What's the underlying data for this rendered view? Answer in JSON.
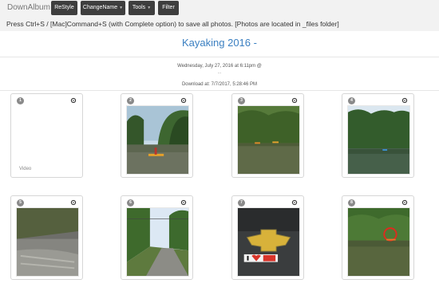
{
  "app": {
    "brand": "DownAlbum",
    "buttons": [
      {
        "label": "ReStyle",
        "has_caret": false
      },
      {
        "label": "ChangeName",
        "has_caret": true
      },
      {
        "label": "Tools",
        "has_caret": true
      },
      {
        "label": "Filter",
        "has_caret": false
      }
    ],
    "instructions": "Press Ctrl+S / [Mac]Command+S (with Complete option) to save all photos. [Photos are located in _files folder]"
  },
  "album": {
    "title": "Kayaking 2016",
    "dash": "-",
    "date": "Wednesday, July 27, 2016 at 6:11pm @",
    "dots": "...",
    "downloaded": "Download at: 7/7/2017, 5:28:46 PM"
  },
  "items": [
    {
      "number": "1",
      "type": "video",
      "caption": "Video",
      "icon": "settings-icon"
    },
    {
      "number": "2",
      "type": "photo",
      "scene": "kayak-river-trees",
      "icon": "settings-icon"
    },
    {
      "number": "3",
      "type": "photo",
      "scene": "river-kayaks-distance",
      "icon": "settings-icon"
    },
    {
      "number": "4",
      "type": "photo",
      "scene": "river-trees-kayak",
      "icon": "settings-icon"
    },
    {
      "number": "5",
      "type": "photo",
      "scene": "rapids-grey",
      "icon": "settings-icon"
    },
    {
      "number": "6",
      "type": "photo",
      "scene": "country-road",
      "icon": "settings-icon"
    },
    {
      "number": "7",
      "type": "photo",
      "scene": "chevy-logo-sticker",
      "icon": "settings-icon"
    },
    {
      "number": "8",
      "type": "photo",
      "scene": "river-circled-kayak",
      "icon": "settings-icon"
    }
  ],
  "colors": {
    "toolbar_bg": "#f2f2f2",
    "button_bg": "#3e3e3e",
    "title_blue": "#3a7fc1",
    "badge_grey": "#8a8a8a"
  }
}
